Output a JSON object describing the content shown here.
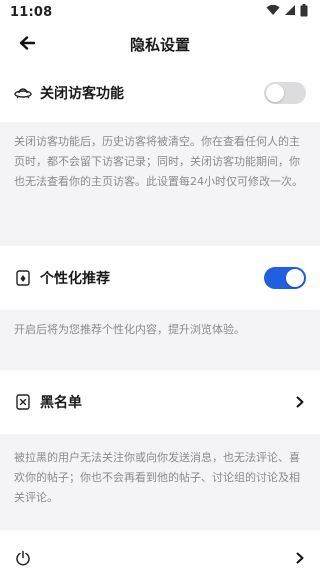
{
  "status_bar": {
    "time": "11:08"
  },
  "header": {
    "title": "隐私设置"
  },
  "visitor_section": {
    "label": "关闭访客功能",
    "toggle_on": false,
    "description": "关闭访客功能后，历史访客将被清空。你在查看任何人的主页时，都不会留下访客记录；同时，关闭访客功能期间，你也无法查看你的主页访客。此设置每24小时仅可修改一次。"
  },
  "personalization_section": {
    "label": "个性化推荐",
    "toggle_on": true,
    "description": "开启后将为您推荐个性化内容，提升浏览体验。"
  },
  "blacklist_section": {
    "label": "黑名单",
    "description": "被拉黑的用户无法关注你或向你发送消息，也无法评论、喜欢你的帖子；你也不会再看到他的帖子、讨论组的讨论及相关评论。"
  },
  "power_section": {
    "label": ""
  },
  "colors": {
    "accent": "#1f5fe0",
    "toggle_off": "#dcdcdf",
    "description_bg": "#f4f4f6",
    "description_text": "#8a8a8f"
  },
  "icons": {
    "back": "arrow-left-icon",
    "visitor": "ufo-icon",
    "personalization": "card-icon",
    "blacklist": "blocked-user-icon",
    "power": "power-icon",
    "chevron": "chevron-right-icon"
  }
}
